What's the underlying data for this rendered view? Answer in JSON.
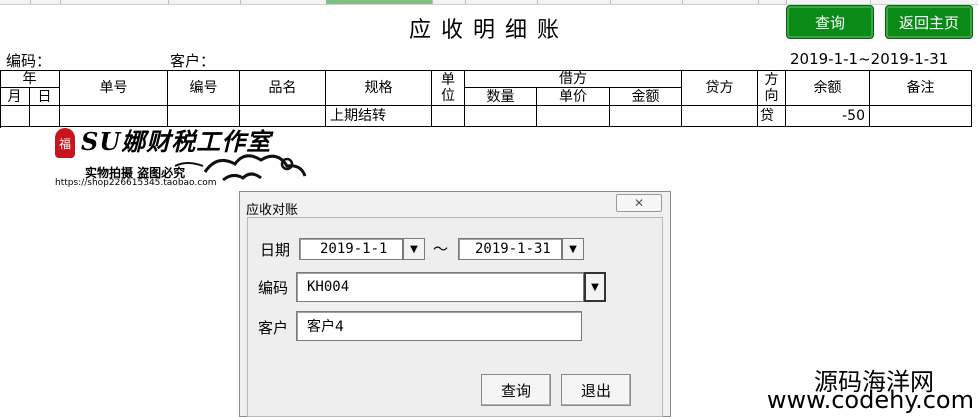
{
  "report": {
    "title": "应收明细账",
    "date_range": "2019-1-1~2019-1-31",
    "code_label": "编码：",
    "customer_label": "客户："
  },
  "toolbar": {
    "query_label": "查询",
    "home_label": "返回主页"
  },
  "table": {
    "headers": {
      "year": "年",
      "month": "月",
      "day": "日",
      "doc_no": "单号",
      "code": "编号",
      "product": "品名",
      "spec": "规格",
      "unit": "单\n位",
      "debit": "借方",
      "qty": "数量",
      "price": "单价",
      "amount": "金额",
      "credit": "贷方",
      "direction": "方\n向",
      "balance": "余额",
      "remark": "备注"
    },
    "rows": [
      {
        "month": "",
        "day": "",
        "doc_no": "",
        "code": "",
        "product": "",
        "spec": "上期结转",
        "unit": "",
        "qty": "",
        "price": "",
        "amount": "",
        "credit": "",
        "direction": "贷",
        "balance": "-50",
        "remark": ""
      }
    ]
  },
  "watermark": {
    "brand_text": "SU娜财税工作室",
    "seal_char": "福",
    "tagline": "实物拍摄  盗图必究",
    "url": "https://shop226615345.taobao.com"
  },
  "dialog": {
    "title": "应收对账",
    "date_label": "日期",
    "date_from": "2019-1-1",
    "date_sep": "～",
    "date_to": "2019-1-31",
    "code_label": "编码",
    "code_value": "KH004",
    "customer_label": "客户",
    "customer_value": "客户4",
    "query_label": "查询",
    "exit_label": "退出"
  },
  "site_mark": {
    "name": "源码海洋网",
    "url": "www.codehy.com"
  },
  "colors": {
    "button_green": "#0b8a18",
    "selected_column": "#7fbf7f"
  }
}
